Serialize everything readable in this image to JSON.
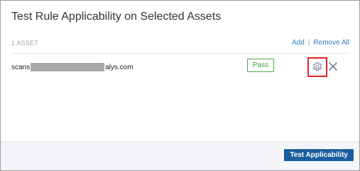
{
  "dialog": {
    "title": "Test Rule Applicability on Selected Assets"
  },
  "asset_list": {
    "count_label": "1 ASSET",
    "add_label": "Add",
    "separator": "|",
    "remove_all_label": "Remove All",
    "items": [
      {
        "name_prefix": "scans",
        "name_suffix": "alys.com",
        "status": "Pass"
      }
    ]
  },
  "footer": {
    "primary_button_label": "Test Applicability"
  },
  "icons": {
    "settings": "gear-icon",
    "remove": "close-icon"
  },
  "colors": {
    "pass": "#3e9a3a",
    "link": "#2f7ac4",
    "primary": "#1a5e9e",
    "highlight": "#e02424"
  }
}
